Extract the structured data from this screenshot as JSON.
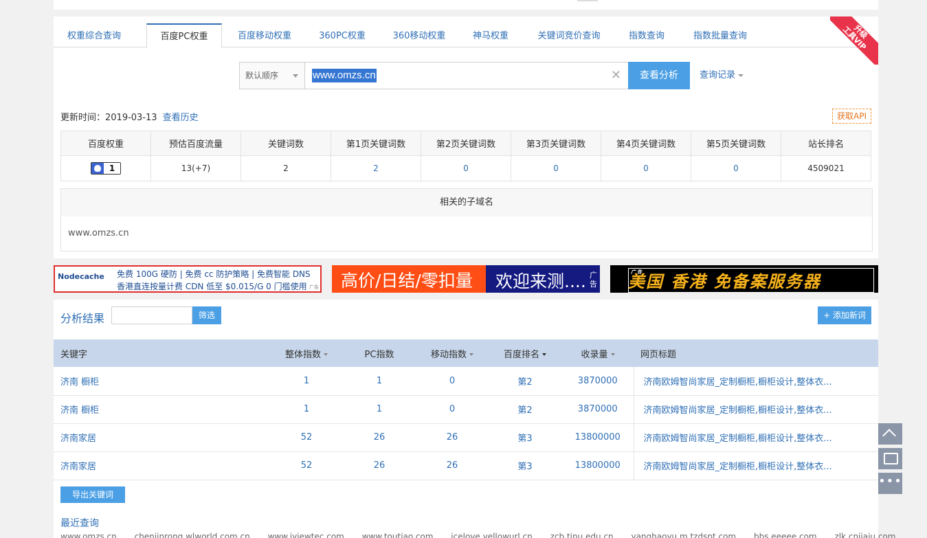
{
  "tabs": [
    {
      "label": "权重综合查询"
    },
    {
      "label": "百度PC权重"
    },
    {
      "label": "百度移动权重"
    },
    {
      "label": "360PC权重"
    },
    {
      "label": "360移动权重"
    },
    {
      "label": "神马权重"
    },
    {
      "label": "关键词竞价查询"
    },
    {
      "label": "指数查询"
    },
    {
      "label": "指数批量查询"
    }
  ],
  "active_tab": "百度PC权重",
  "vip_ribbon": {
    "line1": "升级",
    "line2": "工具VIP"
  },
  "search": {
    "order_label": "默认顺序",
    "query_value": "www.omzs.cn",
    "submit_label": "查看分析",
    "history_label": "查询记录"
  },
  "update": {
    "label": "更新时间：2019-03-13",
    "history_link": "查看历史"
  },
  "api_label": "获取API",
  "stats": {
    "headers": [
      "百度权重",
      "预估百度流量",
      "关键词数",
      "第1页关键词数",
      "第2页关键词数",
      "第3页关键词数",
      "第4页关键词数",
      "第5页关键词数",
      "站长排名"
    ],
    "baidu_rank": "1",
    "traffic": "13(+7)",
    "keywords": "2",
    "page1": "2",
    "page2": "0",
    "page3": "0",
    "page4": "0",
    "page5": "0",
    "site_rank": "4509021"
  },
  "subdomain": {
    "title": "相关的子域名",
    "items": [
      "www.omzs.cn"
    ]
  },
  "ads": {
    "ad1": {
      "logo": "Nodecache",
      "line1": "免费 100G 硬防 | 免费 cc 防护策略 | 免费智能 DNS",
      "line2": "香港直连按量计费 CDN 低至 $0.015/G 0 门槛使用",
      "tag": "广告"
    },
    "ad2": {
      "left": "高价/日结/零扣量",
      "right": "欢迎来测....",
      "tag": "广告"
    },
    "ad3": {
      "text": "美国 香港 免备案服务器",
      "tag": "广告"
    }
  },
  "results": {
    "title": "分析结果",
    "filter_label": "筛选",
    "add_label": "+ 添加新词",
    "columns": [
      "关键字",
      "整体指数",
      "PC指数",
      "移动指数",
      "百度排名",
      "收录量",
      "网页标题"
    ],
    "rows": [
      {
        "keyword": "济南 橱柜",
        "overall": "1",
        "pc": "1",
        "mobile": "0",
        "rank": "第2",
        "indexed": "3870000",
        "title": "济南欧姆智尚家居_定制橱柜,橱柜设计,整体衣..."
      },
      {
        "keyword": "济南 橱柜",
        "overall": "1",
        "pc": "1",
        "mobile": "0",
        "rank": "第2",
        "indexed": "3870000",
        "title": "济南欧姆智尚家居_定制橱柜,橱柜设计,整体衣..."
      },
      {
        "keyword": "济南家居",
        "overall": "52",
        "pc": "26",
        "mobile": "26",
        "rank": "第3",
        "indexed": "13800000",
        "title": "济南欧姆智尚家居_定制橱柜,橱柜设计,整体衣..."
      },
      {
        "keyword": "济南家居",
        "overall": "52",
        "pc": "26",
        "mobile": "26",
        "rank": "第3",
        "indexed": "13800000",
        "title": "济南欧姆智尚家居_定制橱柜,橱柜设计,整体衣..."
      }
    ],
    "export_label": "导出关键词",
    "recent_title": "最近查询",
    "recent": [
      "www.omzs.cn",
      "chenjinrong.wlworld.com.cn",
      "www.jyjewtec.com",
      "www.toutiao.com",
      "icelove.yellowurl.cn",
      "zcb.tinu.edu.cn",
      "yanghaoyu.m.tzdspt.com",
      "bbs.eeeee.com",
      "zlk.cnjiaju.com"
    ]
  },
  "colors": {
    "accent": "#4a9fe5",
    "link": "#2f6fb5",
    "vip": "#e8334a",
    "header_row": "#c7d6ea"
  }
}
